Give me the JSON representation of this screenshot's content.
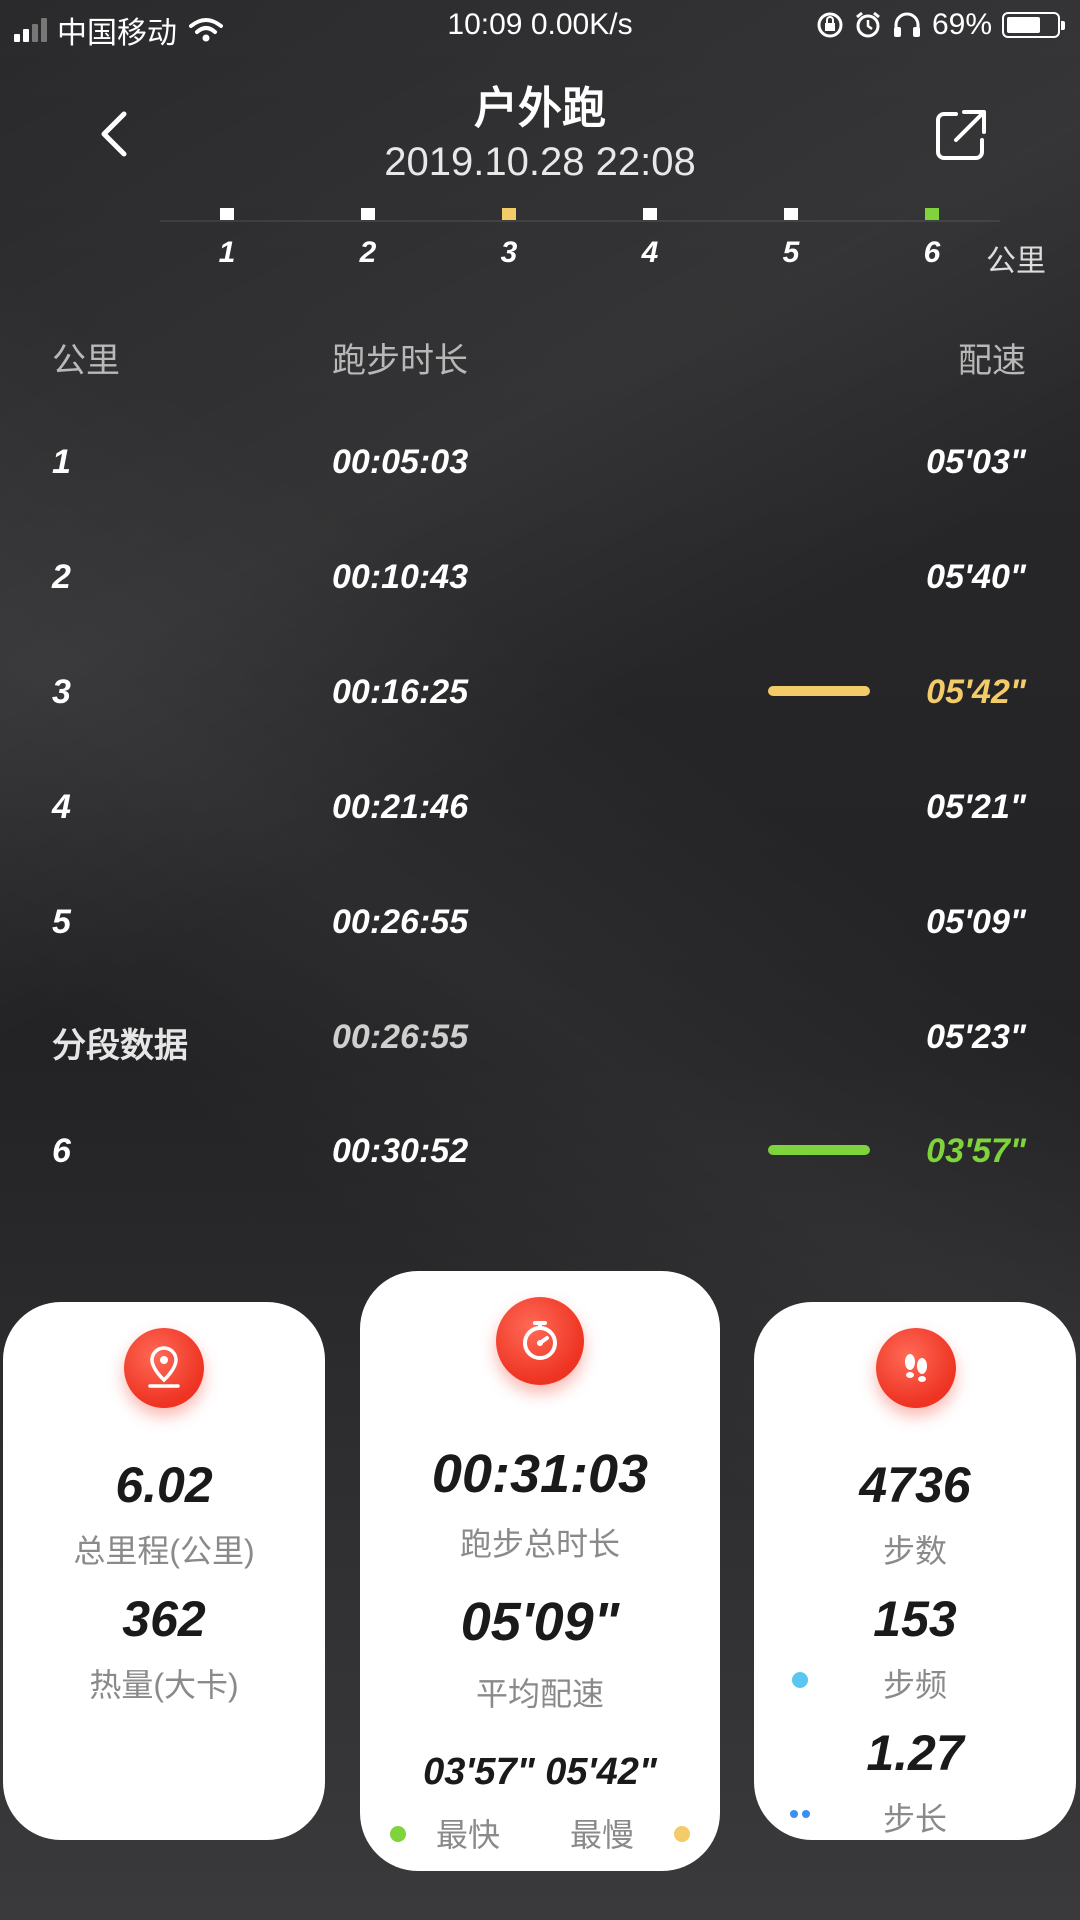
{
  "status": {
    "carrier": "中国移动",
    "time_speed": "10:09 0.00K/s",
    "battery": "69%",
    "battery_level": 0.69
  },
  "header": {
    "title": "户外跑",
    "datetime": "2019.10.28 22:08",
    "back_icon": "chevron-left-icon",
    "share_icon": "share-icon"
  },
  "km_strip": {
    "marks": [
      "1",
      "2",
      "3",
      "4",
      "5",
      "6"
    ],
    "unit": "公里",
    "colors": {
      "normal": "#ffffff",
      "slowest": "#f3cb68",
      "fastest": "#7ed43a"
    }
  },
  "table": {
    "headers": {
      "km": "公里",
      "duration": "跑步时长",
      "pace": "配速"
    },
    "rows": [
      {
        "km": "1",
        "duration": "00:05:03",
        "pace": "05'03\""
      },
      {
        "km": "2",
        "duration": "00:10:43",
        "pace": "05'40\""
      },
      {
        "km": "3",
        "duration": "00:16:25",
        "pace": "05'42\""
      },
      {
        "km": "4",
        "duration": "00:21:46",
        "pace": "05'21\""
      },
      {
        "km": "5",
        "duration": "00:26:55",
        "pace": "05'09\""
      },
      {
        "km": "分段数据",
        "duration": "00:26:55",
        "pace": "05'23\""
      },
      {
        "km": "6",
        "duration": "00:30:52",
        "pace": "03'57\""
      }
    ]
  },
  "cards": {
    "distance": {
      "icon": "location-pin-icon",
      "value": "6.02",
      "label": "总里程(公里)",
      "calories_value": "362",
      "calories_label": "热量(大卡)"
    },
    "time": {
      "icon": "stopwatch-icon",
      "value": "00:31:03",
      "label": "跑步总时长",
      "avg_pace_value": "05'09\"",
      "avg_pace_label": "平均配速",
      "fast_slow_values": "03'57\" 05'42\"",
      "fastest_label": "最快",
      "slowest_label": "最慢"
    },
    "steps": {
      "icon": "footprints-icon",
      "steps_value": "4736",
      "steps_label": "步数",
      "cadence_value": "153",
      "cadence_label": "步频",
      "stride_value": "1.27",
      "stride_label": "步长"
    }
  }
}
